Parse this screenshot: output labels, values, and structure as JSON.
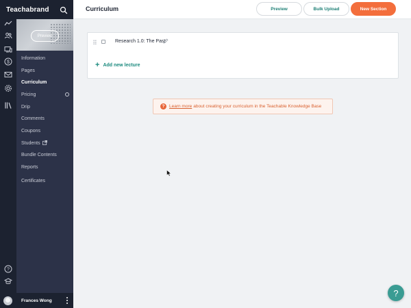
{
  "brand": {
    "name": "Teachabrand"
  },
  "header": {
    "title": "Curriculum",
    "preview_label": "Preview",
    "bulk_upload_label": "Bulk Upload",
    "new_section_label": "New Section"
  },
  "course": {
    "preview_label": "Preview"
  },
  "sidebar": {
    "items": [
      {
        "label": "Information"
      },
      {
        "label": "Pages"
      },
      {
        "label": "Curriculum"
      },
      {
        "label": "Pricing"
      },
      {
        "label": "Drip"
      },
      {
        "label": "Comments"
      },
      {
        "label": "Coupons"
      },
      {
        "label": "Students"
      },
      {
        "label": "Bundle Contents"
      },
      {
        "label": "Reports"
      },
      {
        "label": "Certificates"
      }
    ],
    "active": "Curriculum"
  },
  "rail_icons": [
    "trend-icon",
    "users-icon",
    "devices-icon",
    "dollar-icon",
    "mail-icon",
    "gear-icon",
    "library-icon",
    "help-icon",
    "graduation-icon"
  ],
  "section": {
    "lecture_title": "Research 1.0: The Past",
    "add_lecture_label": "Add new lecture"
  },
  "info": {
    "link_text": "Learn more",
    "text": "about creating your curriculum in the Teachable Knowledge Base"
  },
  "user": {
    "name": "Frances Wong"
  },
  "help": {
    "label": "?"
  },
  "colors": {
    "sidebar_dark": "#1c2230",
    "sidebar": "#2c3248",
    "accent_orange": "#f36e3c",
    "accent_teal": "#1b8a7e"
  }
}
